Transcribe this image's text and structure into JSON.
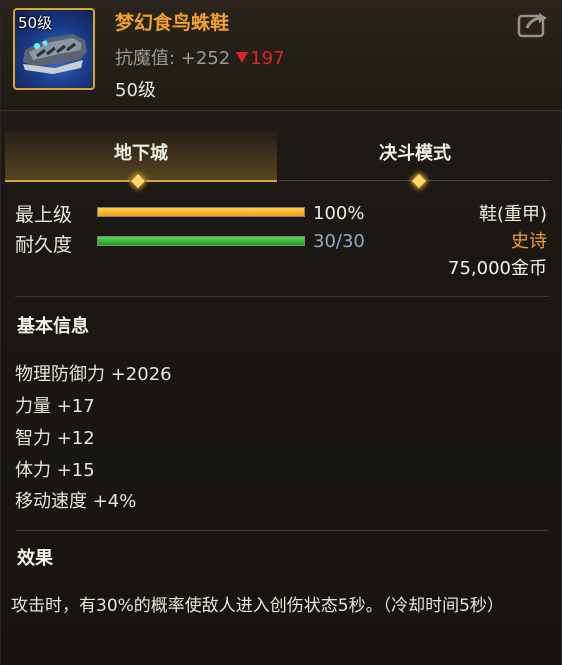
{
  "item": {
    "level_badge": "50级",
    "name": "梦幻食鸟蛛鞋",
    "stat_prefix": "抗魔值: +252",
    "stat_delta": "197",
    "required_level": "50级"
  },
  "tabs": [
    {
      "label": "地下城",
      "active": true
    },
    {
      "label": "决斗模式",
      "active": false
    }
  ],
  "bars": {
    "grade": {
      "label": "最上级",
      "value_text": "100%",
      "fraction": 1.0
    },
    "durability": {
      "label": "耐久度",
      "value_text": "30/30",
      "fraction": 1.0
    }
  },
  "right_info": {
    "type": "鞋(重甲)",
    "rarity": "史诗",
    "price": "75,000金币"
  },
  "basic_info": {
    "title": "基本信息",
    "attributes": [
      "物理防御力 +2026",
      "力量 +17",
      "智力 +12",
      "体力 +15",
      "移动速度 +4%"
    ]
  },
  "effect": {
    "title": "效果",
    "text": "攻击时，有30%的概率使敌人进入创伤状态5秒。（冷却时间5秒）"
  },
  "icons": {
    "item": "boots-icon",
    "share": "share-icon",
    "decrease": "down-triangle-icon"
  },
  "colors": {
    "item_name": "#f0a02a",
    "rarity": "#f0a02a",
    "decrease": "#e02424",
    "durability_value": "#8fa7c9",
    "frame_border": "#d9a62c"
  }
}
